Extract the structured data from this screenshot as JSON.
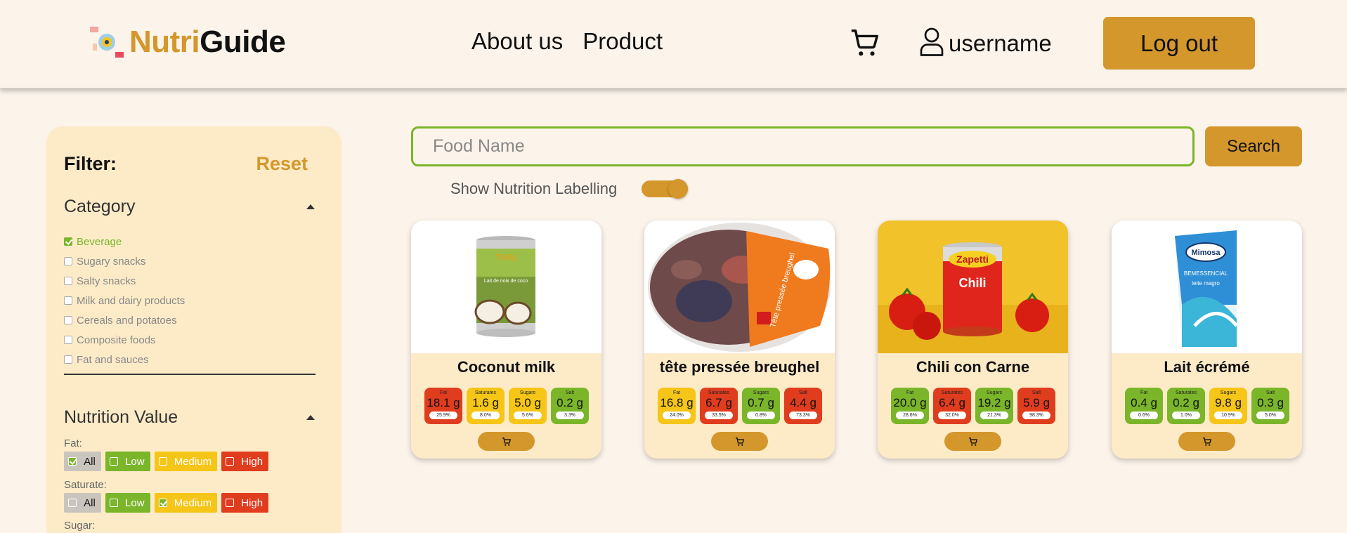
{
  "header": {
    "logo_part1": "Nutri",
    "logo_part2": "Guide",
    "nav": [
      "About us",
      "Product"
    ],
    "username": "username",
    "logout_label": "Log out"
  },
  "filter": {
    "title": "Filter:",
    "reset_label": "Reset",
    "category": {
      "title": "Category",
      "items": [
        {
          "label": "Beverage",
          "checked": true
        },
        {
          "label": "Sugary snacks",
          "checked": false
        },
        {
          "label": "Salty snacks",
          "checked": false
        },
        {
          "label": "Milk and dairy products",
          "checked": false
        },
        {
          "label": "Cereals and potatoes",
          "checked": false
        },
        {
          "label": "Composite foods",
          "checked": false
        },
        {
          "label": "Fat and sauces",
          "checked": false
        }
      ]
    },
    "nutrition": {
      "title": "Nutrition Value",
      "fat_label": "Fat:",
      "saturate_label": "Saturate:",
      "sugar_label": "Sugar:",
      "levels": [
        "All",
        "Low",
        "Medium",
        "High"
      ],
      "fat_selected": "All",
      "saturate_selected": "Medium"
    }
  },
  "search": {
    "placeholder": "Food Name",
    "button_label": "Search",
    "toggle_label": "Show Nutrition Labelling",
    "toggle_on": true
  },
  "products": [
    {
      "name": "Coconut milk",
      "nutrients": [
        {
          "label": "Fat",
          "value": "18.1 g",
          "pct": "25.9%",
          "level": "red"
        },
        {
          "label": "Saturates",
          "value": "1.6 g",
          "pct": "8.0%",
          "level": "amber"
        },
        {
          "label": "Sugars",
          "value": "5.0 g",
          "pct": "5.6%",
          "level": "amber"
        },
        {
          "label": "Salt",
          "value": "0.2 g",
          "pct": "3.3%",
          "level": "green"
        }
      ]
    },
    {
      "name": "tête pressée breughel",
      "nutrients": [
        {
          "label": "Fat",
          "value": "16.8 g",
          "pct": "24.0%",
          "level": "amber"
        },
        {
          "label": "Saturates",
          "value": "6.7 g",
          "pct": "33.5%",
          "level": "red"
        },
        {
          "label": "Sugars",
          "value": "0.7 g",
          "pct": "0.8%",
          "level": "green"
        },
        {
          "label": "Salt",
          "value": "4.4 g",
          "pct": "73.3%",
          "level": "red"
        }
      ]
    },
    {
      "name": "Chili con Carne",
      "nutrients": [
        {
          "label": "Fat",
          "value": "20.0 g",
          "pct": "28.6%",
          "level": "green"
        },
        {
          "label": "Saturates",
          "value": "6.4 g",
          "pct": "32.0%",
          "level": "red"
        },
        {
          "label": "Sugars",
          "value": "19.2 g",
          "pct": "21.3%",
          "level": "green"
        },
        {
          "label": "Salt",
          "value": "5.9 g",
          "pct": "98.3%",
          "level": "red"
        }
      ]
    },
    {
      "name": "Lait écrémé",
      "nutrients": [
        {
          "label": "Fat",
          "value": "0.4 g",
          "pct": "0.6%",
          "level": "green"
        },
        {
          "label": "Saturates",
          "value": "0.2 g",
          "pct": "1.0%",
          "level": "green"
        },
        {
          "label": "Sugars",
          "value": "9.8 g",
          "pct": "10.9%",
          "level": "amber"
        },
        {
          "label": "Salt",
          "value": "0.3 g",
          "pct": "5.0%",
          "level": "green"
        }
      ]
    }
  ],
  "images": {
    "coconut_can_brand": "THAI",
    "coconut_can_text": "Lait de noix de coco",
    "chili_brand": "Zapetti",
    "chili_label": "Chili",
    "milk_brand": "Mimosa",
    "milk_line1": "BEMESSENCIAL",
    "milk_line2": "leite magro",
    "pate_label": "Tête pressée breughel"
  },
  "colors": {
    "accent": "#d4972c",
    "green": "#7ab52a",
    "amber": "#f5c518",
    "red": "#e03c1e",
    "background": "#fcf3ea",
    "panel": "#fdebc8"
  },
  "icons": [
    "logo-icon",
    "cart-icon",
    "user-icon",
    "caret-up-icon",
    "checkbox-icon"
  ]
}
